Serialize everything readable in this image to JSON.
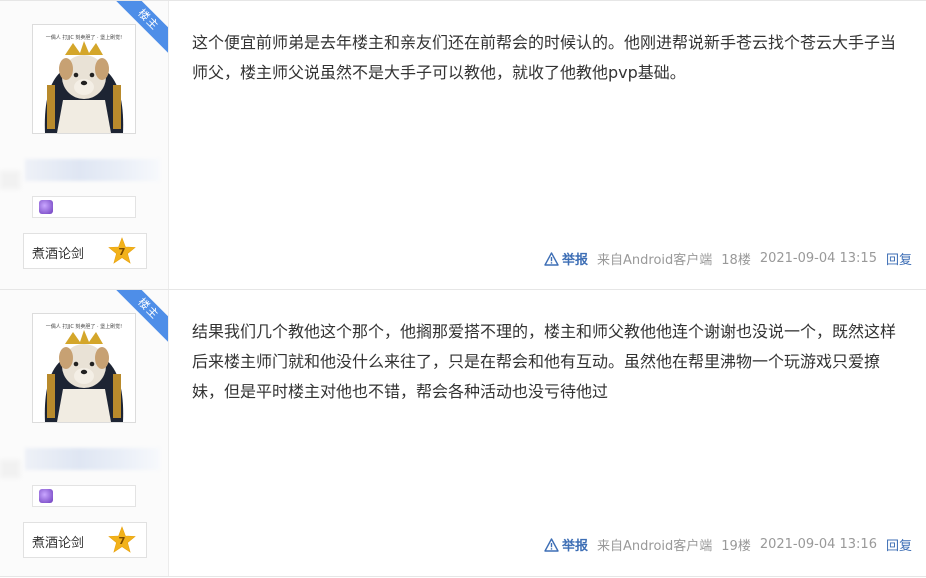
{
  "posts": [
    {
      "ribbon": "楼主",
      "avatar_caption": "一偶人 打JJC 刻卖胆了 · 堡上刷觉!",
      "level_name": "煮酒论剑",
      "level_number": "7",
      "content": "这个便宜前师弟是去年楼主和亲友们还在前帮会的时候认的。他刚进帮说新手苍云找个苍云大手子当师父，楼主师父说虽然不是大手子可以教他，就收了他教他pvp基础。",
      "report_label": "举报",
      "client": "来自Android客户端",
      "floor": "18楼",
      "time": "2021-09-04 13:15",
      "reply_label": "回复"
    },
    {
      "ribbon": "楼主",
      "avatar_caption": "一偶人 打JJC 刻卖胆了 · 堡上刷觉!",
      "level_name": "煮酒论剑",
      "level_number": "7",
      "content": "结果我们几个教他这个那个，他搁那爱搭不理的，楼主和师父教他他连个谢谢也没说一个，既然这样后来楼主师门就和他没什么来往了，只是在帮会和他有互动。虽然他在帮里沸物一个玩游戏只爱撩妹，但是平时楼主对他也不错，帮会各种活动也没亏待他过",
      "report_label": "举报",
      "client": "来自Android客户端",
      "floor": "19楼",
      "time": "2021-09-04 13:16",
      "reply_label": "回复"
    }
  ],
  "colors": {
    "ribbon": "#4e8ee8",
    "link": "#3d6eb5",
    "meta_gray": "#999999",
    "star": "#f2b21b"
  },
  "icons": [
    "warning-triangle-icon",
    "level-star-icon",
    "badge-gem-icon"
  ]
}
